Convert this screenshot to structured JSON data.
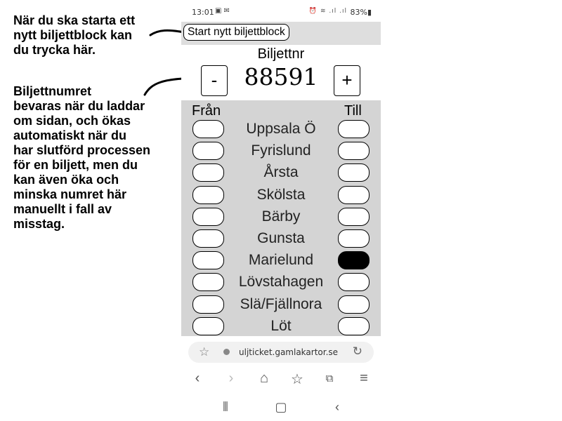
{
  "annotations": {
    "note1": "När du ska starta ett\nnytt biljettblock kan\ndu trycka här.",
    "note2": "Biljettnumret\nbevaras när du laddar\nom sidan, och ökas\nautomatiskt när du\nhar slutförd processen\nför en biljett, men du\nkan även öka och\nminska numret här\nmanuellt i fall av\nmisstag."
  },
  "status_bar": {
    "time": "13:01",
    "left_icons": [
      "image-icon",
      "mail-icon"
    ],
    "right_icons": [
      "alarm-icon",
      "wifi-icon",
      "signal-icon"
    ],
    "battery": "83%"
  },
  "start_button_label": "Start nytt biljettblock",
  "ticket": {
    "label": "Biljettnr",
    "number": "88591",
    "minus_label": "-",
    "plus_label": "+"
  },
  "stops": {
    "from_header": "Från",
    "to_header": "Till",
    "list": [
      {
        "name": "Uppsala Ö",
        "from_selected": false,
        "to_selected": false
      },
      {
        "name": "Fyrislund",
        "from_selected": false,
        "to_selected": false
      },
      {
        "name": "Årsta",
        "from_selected": false,
        "to_selected": false
      },
      {
        "name": "Skölsta",
        "from_selected": false,
        "to_selected": false
      },
      {
        "name": "Bärby",
        "from_selected": false,
        "to_selected": false
      },
      {
        "name": "Gunsta",
        "from_selected": false,
        "to_selected": false
      },
      {
        "name": "Marielund",
        "from_selected": false,
        "to_selected": true
      },
      {
        "name": "Lövstahagen",
        "from_selected": false,
        "to_selected": false
      },
      {
        "name": "Slä/Fjällnora",
        "from_selected": false,
        "to_selected": false
      },
      {
        "name": "Löt",
        "from_selected": false,
        "to_selected": false
      }
    ]
  },
  "browser": {
    "url": "uljticket.gamlakartor.se",
    "nav_icons": [
      "back-icon",
      "forward-icon",
      "home-icon",
      "bookmarks-icon",
      "tabs-icon",
      "menu-icon"
    ]
  },
  "system_nav": [
    "recent-apps-icon",
    "home-button-icon",
    "back-button-icon"
  ]
}
